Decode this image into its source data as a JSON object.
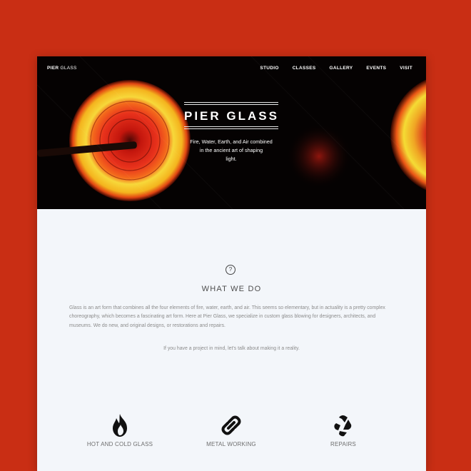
{
  "brand": {
    "bold": "PIER",
    "light": "GLASS"
  },
  "nav": {
    "items": [
      "STUDIO",
      "CLASSES",
      "GALLERY",
      "EVENTS",
      "VISIT"
    ]
  },
  "hero": {
    "title": "PIER GLASS",
    "tagline_lines": [
      "Fire, Water, Earth, and Air combined",
      "in the ancient art of shaping",
      "light."
    ]
  },
  "about": {
    "title": "WHAT WE DO",
    "lines": [
      "Glass is an art form that combines all the four elements of fire, water, earth, and air. This seems so elementary, but in actuality is a pretty complex",
      "choreography, which becomes a fascinating art form. Here at Pier Glass, we specialize in custom glass blowing for designers, architects, and",
      "museums. We do new, and original designs, or restorations and repairs."
    ],
    "cta": "If you have a project in mind, let's talk about making it a reality."
  },
  "features": [
    {
      "label": "HOT AND COLD GLASS",
      "icon": "flame-icon"
    },
    {
      "label": "METAL WORKING",
      "icon": "chain-link-icon"
    },
    {
      "label": "REPAIRS",
      "icon": "recycle-icon"
    }
  ],
  "colors": {
    "background": "#c92e14",
    "hero": "#050202",
    "glow_outer": "#f5cf2a",
    "glow_inner": "#e8281a",
    "content_bg": "#f3f6fa"
  }
}
